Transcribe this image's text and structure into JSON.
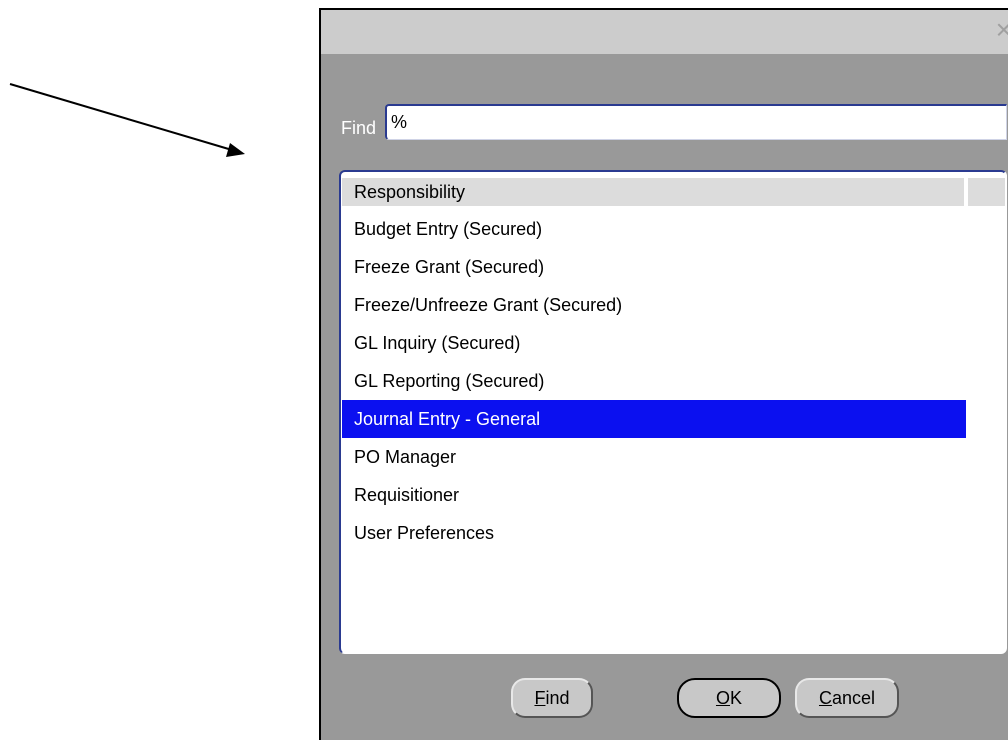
{
  "dialog": {
    "close_glyph": "×",
    "find_label": "Find",
    "find_value": "%",
    "list": {
      "header": "Responsibility",
      "items": [
        "Budget Entry (Secured)",
        "Freeze Grant (Secured)",
        "Freeze/Unfreeze Grant (Secured)",
        "GL Inquiry (Secured)",
        "GL Reporting (Secured)",
        "Journal Entry - General",
        "PO Manager",
        "Requisitioner",
        "User Preferences"
      ],
      "selected_item": "Journal Entry - General"
    },
    "buttons": {
      "find_mnemonic": "F",
      "find_rest": "ind",
      "ok_mnemonic": "O",
      "ok_rest": "K",
      "cancel_mnemonic": "C",
      "cancel_rest": "ancel"
    }
  },
  "colors": {
    "dialog_body": "#999999",
    "title_bar": "#cccccc",
    "selection": "#0b10f0",
    "focus_border": "#2a3a90"
  },
  "icons": {
    "pointer_arrow": "arrow-icon",
    "close": "close-icon"
  }
}
